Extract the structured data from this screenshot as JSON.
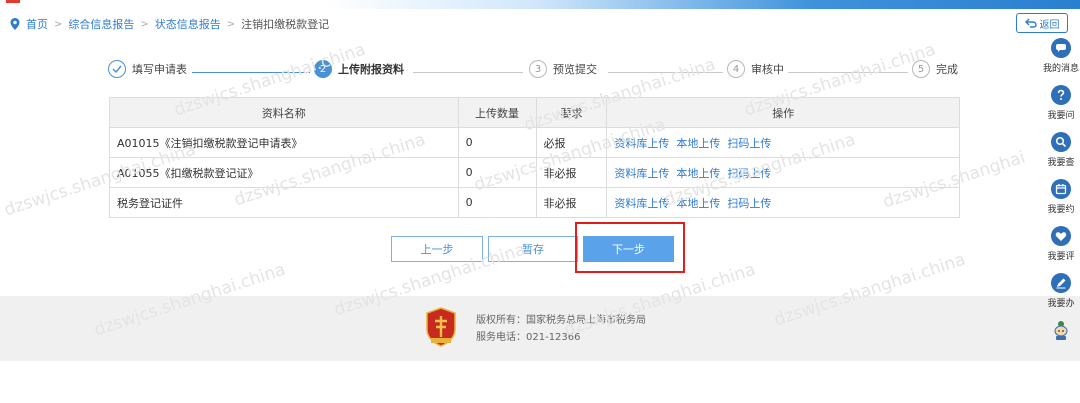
{
  "breadcrumb": {
    "home": "首页",
    "level1": "综合信息报告",
    "level2": "状态信息报告",
    "current": "注销扣缴税款登记",
    "separator": ">"
  },
  "back_button": {
    "label": "返回"
  },
  "steps": [
    {
      "number": "1",
      "label": "填写申请表",
      "state": "done"
    },
    {
      "number": "2",
      "label": "上传附报资料",
      "state": "active"
    },
    {
      "number": "3",
      "label": "预览提交",
      "state": "pending"
    },
    {
      "number": "4",
      "label": "审核中",
      "state": "pending"
    },
    {
      "number": "5",
      "label": "完成",
      "state": "pending"
    }
  ],
  "table": {
    "headers": [
      "资料名称",
      "上传数量",
      "要求",
      "操作"
    ],
    "rows": [
      {
        "name": "A01015《注销扣缴税款登记申请表》",
        "count": "0",
        "requirement": "必报"
      },
      {
        "name": "A01055《扣缴税款登记证》",
        "count": "0",
        "requirement": "非必报"
      },
      {
        "name": "税务登记证件",
        "count": "0",
        "requirement": "非必报"
      }
    ],
    "actions": [
      "资料库上传",
      "本地上传",
      "扫码上传"
    ]
  },
  "buttons": {
    "prev": "上一步",
    "save": "暂存",
    "next": "下一步"
  },
  "footer": {
    "copyright": "版权所有：国家税务总局上海市税务局",
    "phone": "服务电话：021-12366"
  },
  "sidebar": [
    {
      "label": "我的消息",
      "icon": "chat-icon"
    },
    {
      "label": "我要问",
      "icon": "question-icon"
    },
    {
      "label": "我要查",
      "icon": "search-icon"
    },
    {
      "label": "我要约",
      "icon": "calendar-icon"
    },
    {
      "label": "我要评",
      "icon": "heart-icon"
    },
    {
      "label": "我要办",
      "icon": "pen-icon"
    }
  ],
  "colors": {
    "accent": "#4a90d9",
    "link": "#2f7bd2",
    "primary_button": "#5aa3ea",
    "highlight": "#e01e1e",
    "sidebar_icon": "#2e6fb8"
  }
}
